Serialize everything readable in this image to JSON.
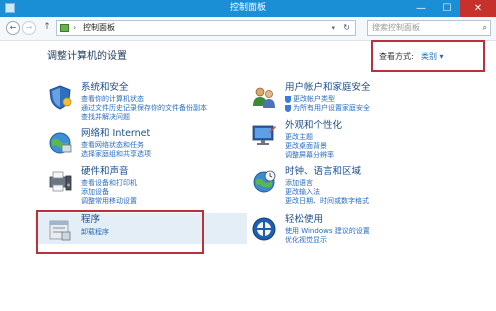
{
  "window": {
    "title": "控制面板",
    "minimize": "—",
    "maximize": "☐",
    "close": "✕"
  },
  "address_bar": {
    "back_glyph": "←",
    "forward_glyph": "→",
    "up_glyph": "↑",
    "separator": "›",
    "breadcrumb": "控制面板",
    "dropdown": "▾",
    "refresh": "↻",
    "search_placeholder": "搜索控制面板",
    "search_glyph": "⌕"
  },
  "main": {
    "title": "调整计算机的设置"
  },
  "view_by": {
    "label": "查看方式:",
    "value": "类别",
    "arrow": "▾"
  },
  "categories": [
    {
      "name": "系统和安全",
      "icon": "security-shield-icon",
      "links": [
        "查看你的计算机状态",
        "通过文件历史记录保存你的文件备份副本",
        "查找并解决问题"
      ]
    },
    {
      "name": "网络和 Internet",
      "icon": "network-globe-icon",
      "links": [
        "查看网络状态和任务",
        "选择家庭组和共享选项"
      ]
    },
    {
      "name": "硬件和声音",
      "icon": "printer-speaker-icon",
      "links": [
        "查看设备和打印机",
        "添加设备",
        "调整常用移动设置"
      ]
    },
    {
      "name": "程序",
      "icon": "programs-icon",
      "links": [
        "卸载程序"
      ]
    },
    {
      "name": "用户帐户和家庭安全",
      "icon": "users-icon",
      "links": [
        "更改帐户类型",
        "为所有用户设置家庭安全"
      ]
    },
    {
      "name": "外观和个性化",
      "icon": "display-personalize-icon",
      "links": [
        "更改主题",
        "更改桌面背景",
        "调整屏幕分辨率"
      ]
    },
    {
      "name": "时钟、语言和区域",
      "icon": "clock-globe-icon",
      "links": [
        "添加语言",
        "更改输入法",
        "更改日期、时间或数字格式"
      ]
    },
    {
      "name": "轻松使用",
      "icon": "ease-of-access-icon",
      "links": [
        "使用 Windows 建议的设置",
        "优化视觉显示"
      ]
    }
  ]
}
